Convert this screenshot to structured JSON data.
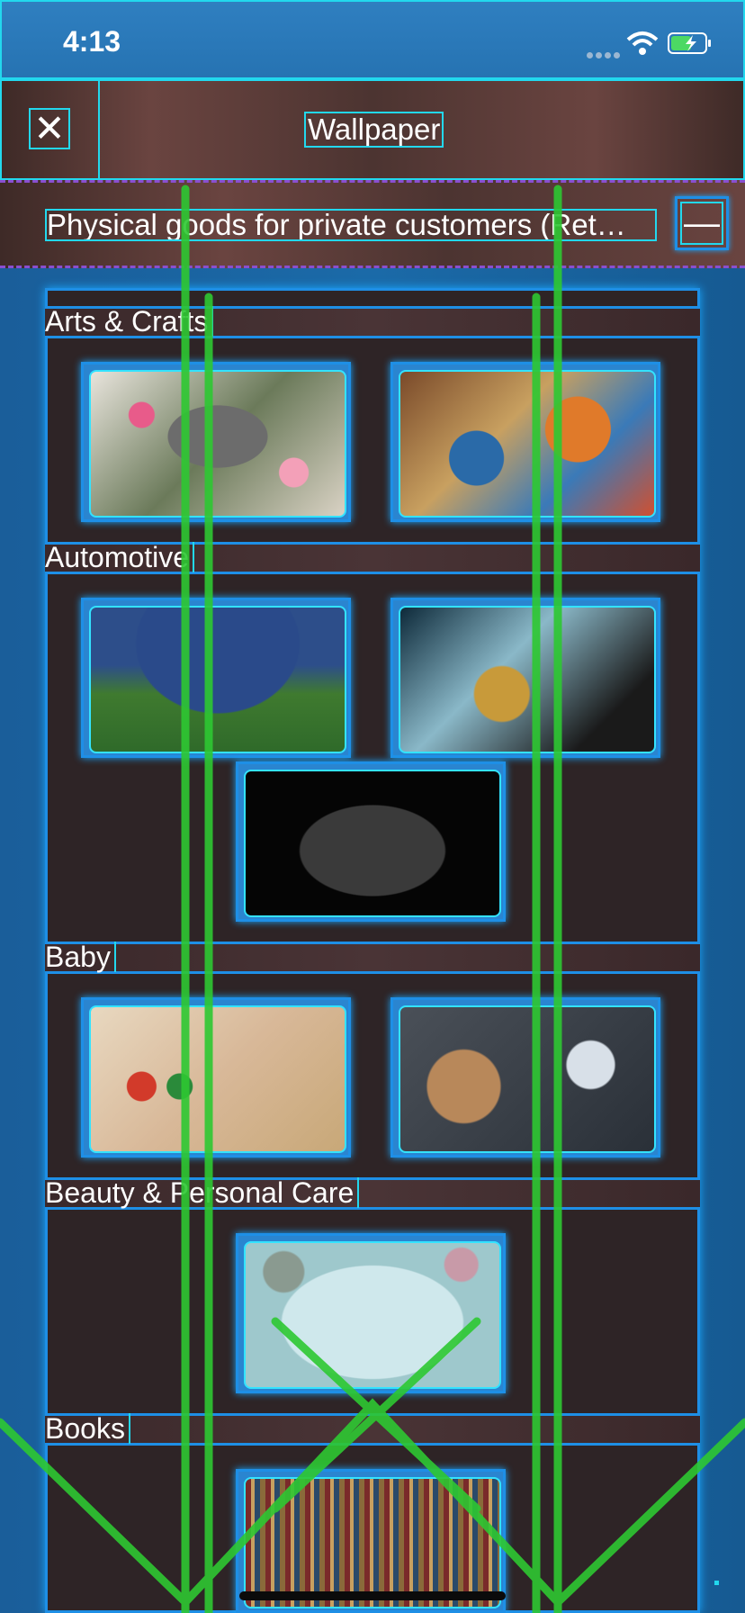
{
  "status_bar": {
    "time": "4:13",
    "signal_icon": "cellular-signal-icon",
    "wifi_icon": "wifi-icon",
    "battery_icon": "battery-charging-icon"
  },
  "nav": {
    "title": "Wallpaper",
    "close_icon": "close-icon",
    "close_glyph": "✕"
  },
  "filter": {
    "text": "Physical goods for private customers (Ret…",
    "collapse_icon": "minus-icon",
    "collapse_glyph": "—"
  },
  "categories": [
    {
      "label": "Arts & Crafts",
      "images": [
        "flowers-crafts-image",
        "paint-brushes-image"
      ]
    },
    {
      "label": "Automotive",
      "images": [
        "vintage-car-rear-image",
        "car-dashboard-image",
        "black-car-front-image"
      ]
    },
    {
      "label": "Baby",
      "images": [
        "wooden-toys-image",
        "teddy-bear-image"
      ]
    },
    {
      "label": "Beauty & Personal Care",
      "images": [
        "beauty-products-image"
      ]
    },
    {
      "label": "Books",
      "images": [
        "library-shelves-image"
      ]
    }
  ],
  "colors": {
    "overlay_green": "#2ec832",
    "accent_cyan": "#22d8ee",
    "accent_blue": "#1e8fe6"
  }
}
